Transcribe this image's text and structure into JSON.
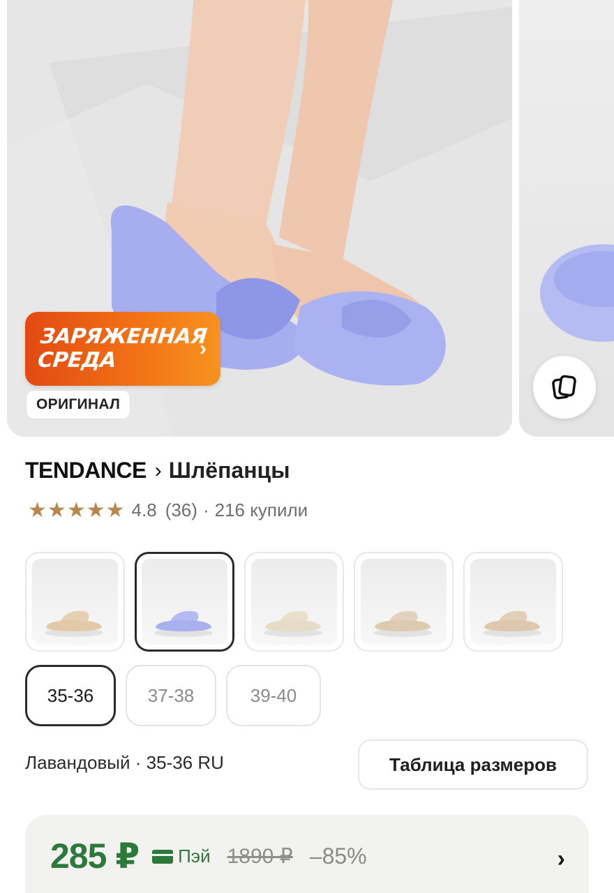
{
  "gallery": {
    "promo": {
      "line1": "ЗАРЯЖЕННАЯ",
      "line2": "СРЕДА",
      "chevron": "›"
    },
    "original_badge": "ОРИГИНАЛ",
    "fullscreen_icon": "copy-icon"
  },
  "product": {
    "brand": "TENDANCE",
    "separator": "›",
    "category": "Шлёпанцы",
    "rating": {
      "stars": 5,
      "value": "4.8",
      "count": "(36)",
      "dot": "·",
      "purchased": "216 купили"
    }
  },
  "variants": [
    {
      "name": "beige",
      "color": "#e3c9a8",
      "selected": false
    },
    {
      "name": "lavender",
      "color": "#a8b0ee",
      "selected": true
    },
    {
      "name": "cream",
      "color": "#e7dcc5",
      "selected": false
    },
    {
      "name": "sand",
      "color": "#ddcbb0",
      "selected": false
    },
    {
      "name": "latte",
      "color": "#ddc8ad",
      "selected": false
    }
  ],
  "sizes": [
    {
      "label": "35-36",
      "selected": true
    },
    {
      "label": "37-38",
      "selected": false
    },
    {
      "label": "39-40",
      "selected": false
    }
  ],
  "selection_summary": "Лавандовый · 35-36 RU",
  "size_table_button": "Таблица размеров",
  "price": {
    "current": "285 ₽",
    "pay_label": "Пэй",
    "old": "1890 ₽",
    "discount": "–85%",
    "chevron": "›"
  },
  "colors": {
    "price_green": "#2b7a3b",
    "star": "#b8874a",
    "promo_orange": "#f27016"
  }
}
